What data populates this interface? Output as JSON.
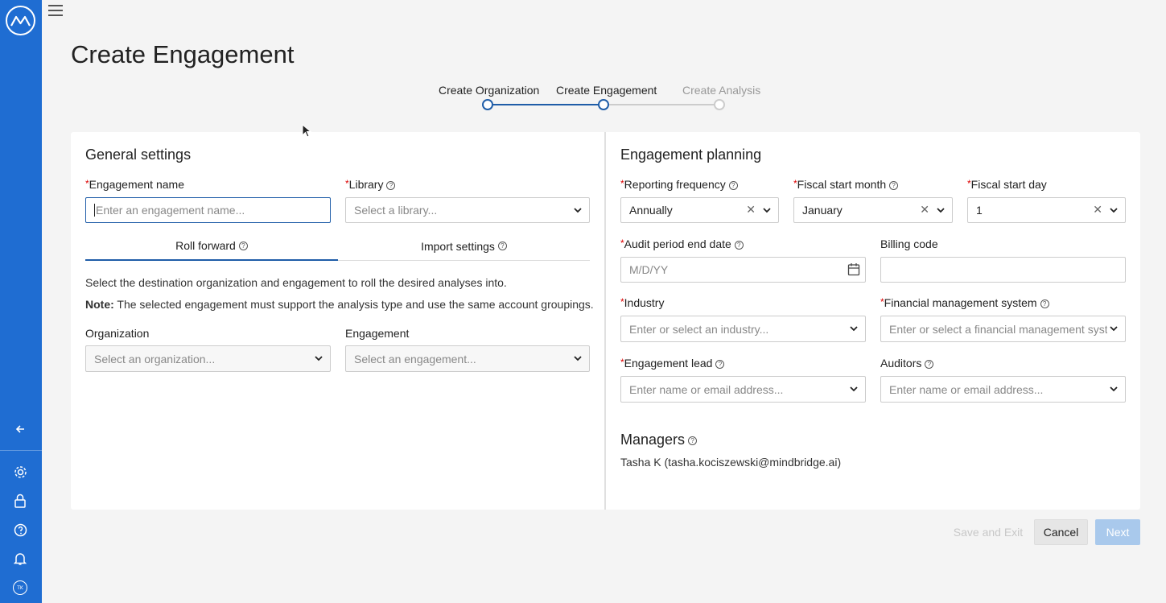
{
  "page": {
    "title": "Create Engagement"
  },
  "sidebar": {
    "avatar_initials": "TK",
    "icons": [
      "back-arrow-icon",
      "gear-icon",
      "lock-icon",
      "help-icon",
      "bell-icon"
    ]
  },
  "stepper": {
    "steps": [
      {
        "label": "Create Organization",
        "state": "complete"
      },
      {
        "label": "Create Engagement",
        "state": "current"
      },
      {
        "label": "Create Analysis",
        "state": "inactive"
      }
    ]
  },
  "general": {
    "title": "General settings",
    "engagement_name_label": "Engagement name",
    "engagement_name_placeholder": "Enter an engagement name...",
    "library_label": "Library",
    "library_placeholder": "Select a library...",
    "tabs": [
      "Roll forward",
      "Import settings"
    ],
    "description": "Select the destination organization and engagement to roll the desired analyses into.",
    "note_label": "Note:",
    "note_text": "The selected engagement must support the analysis type and use the same account groupings.",
    "organization_label": "Organization",
    "organization_placeholder": "Select an organization...",
    "engagement_label": "Engagement",
    "engagement_placeholder": "Select an engagement..."
  },
  "planning": {
    "title": "Engagement planning",
    "reporting_frequency_label": "Reporting frequency",
    "reporting_frequency_value": "Annually",
    "fiscal_start_month_label": "Fiscal start month",
    "fiscal_start_month_value": "January",
    "fiscal_start_day_label": "Fiscal start day",
    "fiscal_start_day_value": "1",
    "audit_period_end_label": "Audit period end date",
    "audit_period_end_placeholder": "M/D/YY",
    "billing_code_label": "Billing code",
    "industry_label": "Industry",
    "industry_placeholder": "Enter or select an industry...",
    "fms_label": "Financial management system",
    "fms_placeholder": "Enter or select a financial management system",
    "engagement_lead_label": "Engagement lead",
    "engagement_lead_placeholder": "Enter name or email address...",
    "auditors_label": "Auditors",
    "auditors_placeholder": "Enter name or email address...",
    "managers_title": "Managers",
    "manager_entry": "Tasha K (tasha.kociszewski@mindbridge.ai)"
  },
  "footer": {
    "save_exit_label": "Save and Exit",
    "cancel_label": "Cancel",
    "next_label": "Next"
  },
  "colors": {
    "sidebar": "#1f6dd2",
    "accent": "#1f5da8",
    "required": "#dd0000",
    "next_disabled": "#a9c9ec"
  }
}
